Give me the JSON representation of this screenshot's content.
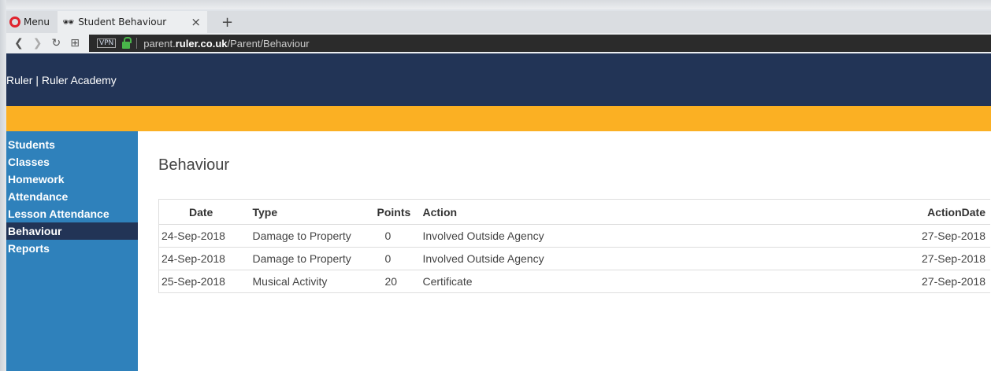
{
  "browser": {
    "menu_label": "Menu",
    "tab_title": "Student Behaviour",
    "tab_close": "×",
    "new_tab": "+",
    "vpn_label": "VPN",
    "url_prefix": "parent.",
    "url_domain": "ruler.co.uk",
    "url_path": "/Parent/Behaviour"
  },
  "header": {
    "title": "Ruler | Ruler Academy"
  },
  "sidebar": {
    "items": [
      {
        "label": "Students"
      },
      {
        "label": "Classes"
      },
      {
        "label": "Homework"
      },
      {
        "label": "Attendance"
      },
      {
        "label": "Lesson Attendance"
      },
      {
        "label": "Behaviour",
        "active": true
      },
      {
        "label": "Reports"
      }
    ]
  },
  "main": {
    "title": "Behaviour",
    "table": {
      "headers": [
        "Date",
        "Type",
        "Points",
        "Action",
        "ActionDate"
      ],
      "rows": [
        [
          "24-Sep-2018",
          "Damage to Property",
          "0",
          "Involved Outside Agency",
          "27-Sep-2018"
        ],
        [
          "24-Sep-2018",
          "Damage to Property",
          "0",
          "Involved Outside Agency",
          "27-Sep-2018"
        ],
        [
          "25-Sep-2018",
          "Musical Activity",
          "20",
          "Certificate",
          "27-Sep-2018"
        ]
      ]
    }
  },
  "colors": {
    "header_bg": "#223456",
    "accent_stripe": "#fbb023",
    "sidebar_bg": "#2f81bb",
    "sidebar_active_bg": "#223456"
  }
}
